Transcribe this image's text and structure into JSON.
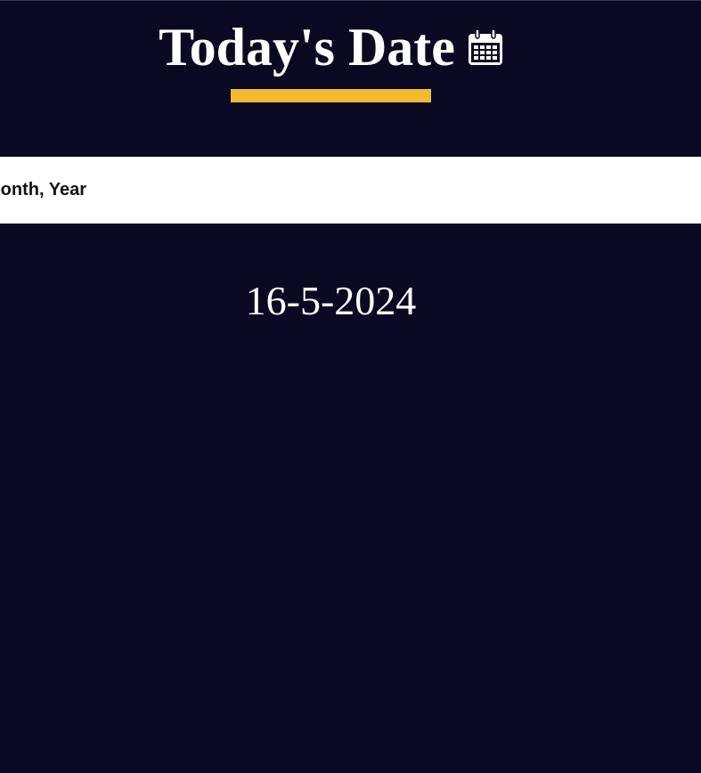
{
  "header": {
    "title": "Today's Date",
    "icon": "calendar-icon",
    "accent_color": "#f2bb2f"
  },
  "format_bar": {
    "label": "Day, Month, Year"
  },
  "date": {
    "value": "16-5-2024"
  },
  "colors": {
    "background": "#090a22",
    "text": "#ffffff",
    "band": "#ffffff"
  }
}
